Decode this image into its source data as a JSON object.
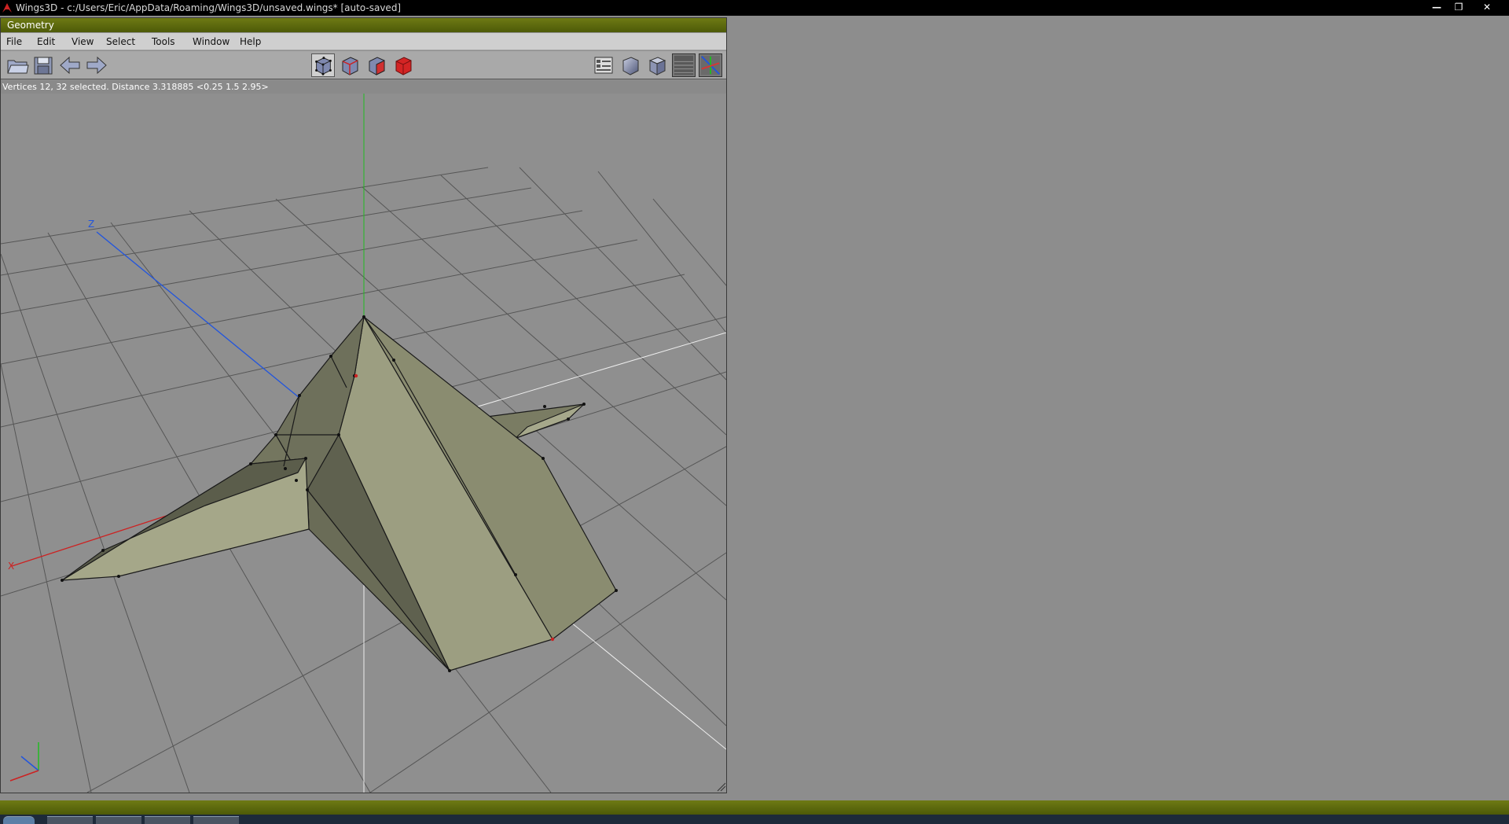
{
  "window": {
    "title": "Wings3D - c:/Users/Eric/AppData/Roaming/Wings3D/unsaved.wings* [auto-saved]",
    "controls": [
      "minimize",
      "restore",
      "close"
    ]
  },
  "geometry_window": {
    "title": "Geometry",
    "menu": [
      "File",
      "Edit",
      "View",
      "Select",
      "Tools",
      "Window",
      "Help"
    ],
    "toolbar_left": [
      {
        "icon": "open-folder-icon"
      },
      {
        "icon": "save-disk-icon"
      },
      {
        "icon": "undo-arrow-icon"
      },
      {
        "icon": "redo-arrow-icon"
      }
    ],
    "selection_modes": [
      {
        "icon": "vertex-mode-icon",
        "selected": true
      },
      {
        "icon": "edge-mode-icon",
        "selected": false
      },
      {
        "icon": "face-mode-icon",
        "selected": false
      },
      {
        "icon": "body-mode-icon",
        "selected": false
      }
    ],
    "toolbar_right": [
      {
        "icon": "workmode-icon"
      },
      {
        "icon": "smooth-shading-icon"
      },
      {
        "icon": "flat-shading-icon"
      },
      {
        "icon": "ground-plane-icon",
        "active": true
      },
      {
        "icon": "axes-toggle-icon",
        "active": true
      }
    ],
    "status": "Vertices 12, 32 selected. Distance 3.318885  <0.25  1.5  2.95>"
  },
  "viewport": {
    "axis_labels": {
      "z": "Z",
      "x": "X"
    },
    "colors": {
      "background": "#8f8f8f",
      "grid": "#5a5a5a",
      "mesh_light": "#9a9c80",
      "mesh_mid": "#7d7f66",
      "mesh_dark": "#5e6050",
      "x_axis": "#cc2222",
      "y_axis": "#22bb22",
      "z_axis": "#2255dd",
      "title_bar": "#5c6a0e"
    }
  },
  "taskbar": {
    "buttons": 5
  }
}
